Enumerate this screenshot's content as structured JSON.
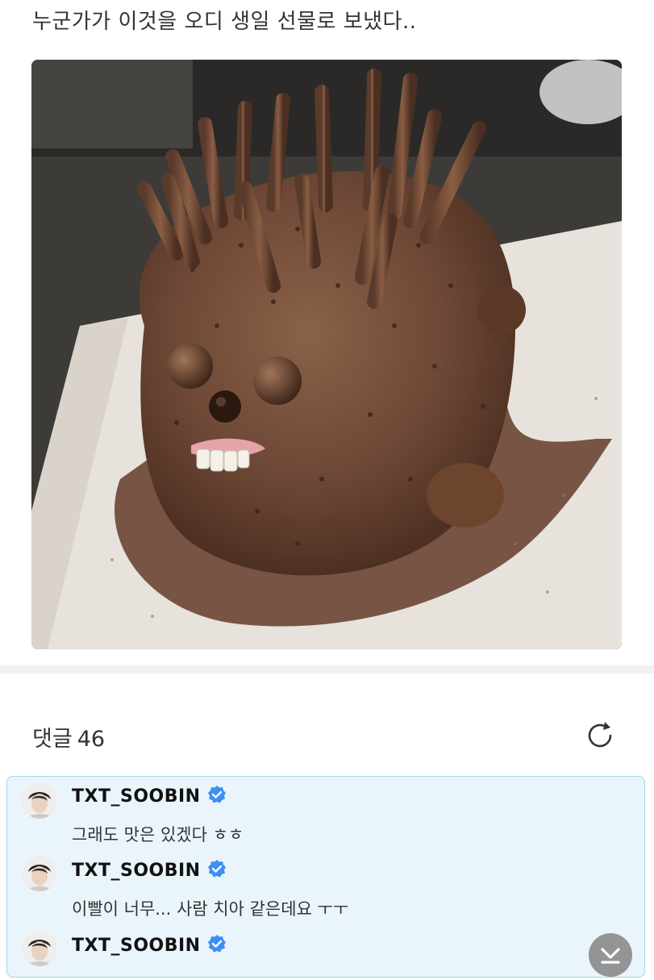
{
  "post": {
    "title": "누군가가 이것을 오디 생일 선물로 보냈다.."
  },
  "comments_section": {
    "label": "댓글",
    "count": "46"
  },
  "comments": [
    {
      "user": "TXT_SOOBIN",
      "text": "그래도 맛은 있겠다 ㅎㅎ"
    },
    {
      "user": "TXT_SOOBIN",
      "text": "이빨이 너무... 사람 치아 같은데요 ㅜㅜ"
    },
    {
      "user": "TXT_SOOBIN",
      "text": ""
    }
  ],
  "colors": {
    "comment_bg": "#eaf5fb",
    "comment_border": "#a9d3ea",
    "verified": "#3d8ef5",
    "divider": "#f1f1f3"
  },
  "icons": {
    "refresh": "refresh-icon",
    "verified": "verified-badge-icon",
    "scroll": "chevron-down-icon"
  }
}
